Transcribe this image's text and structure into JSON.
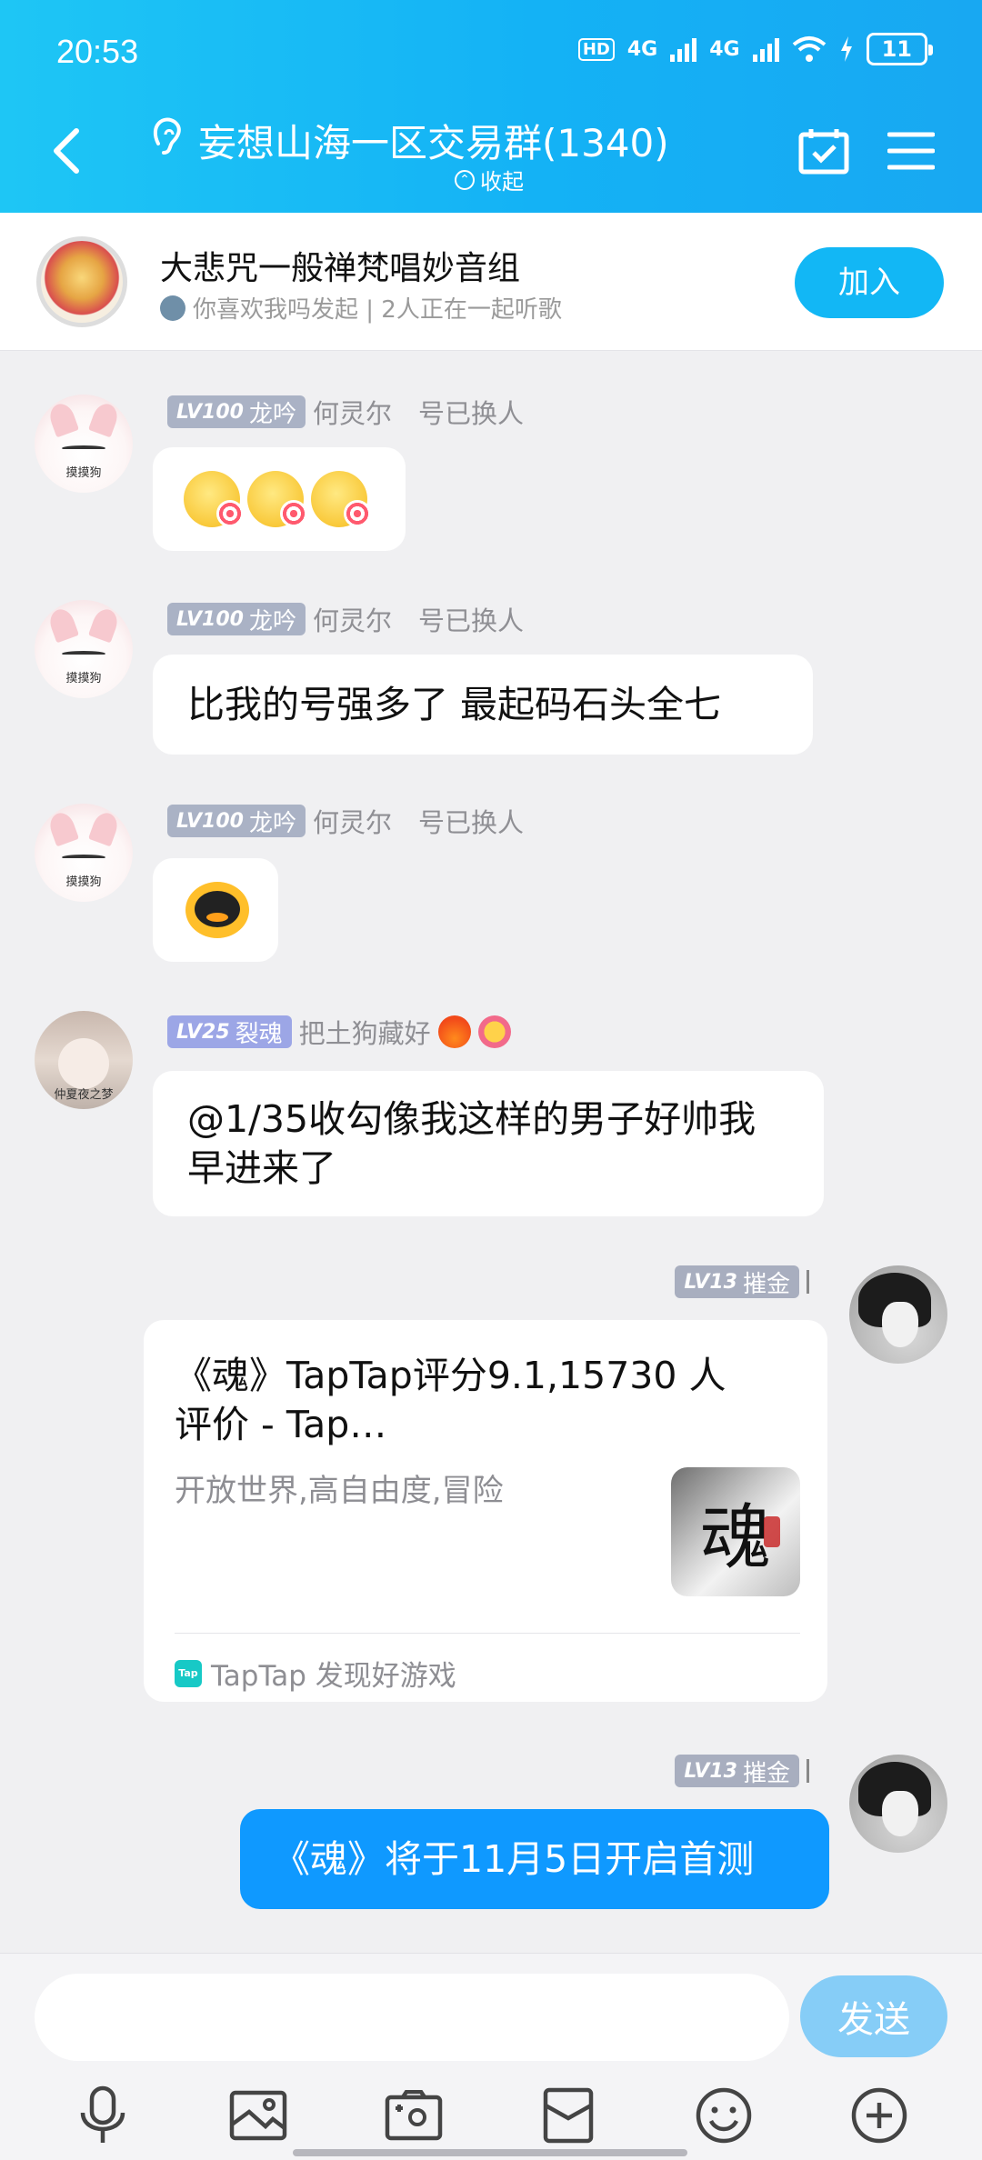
{
  "status_bar": {
    "time": "20:53",
    "network_hd": "HD",
    "net1": "4G",
    "net2": "4G",
    "battery": "11"
  },
  "header": {
    "title": "妄想山海一区交易群(1340)",
    "collapse_label": "收起",
    "background_color": "#14b2f5"
  },
  "banner": {
    "title": "大悲咒一般禅梵唱妙音组",
    "subtitle": "你喜欢我吗发起 | 2人正在一起听歌",
    "join_label": "加入"
  },
  "messages": [
    {
      "level": "LV100",
      "title": "龙吟",
      "nickname": "何灵尔　号已换人",
      "avatar_caption": "摸摸狗",
      "content_type": "emoji",
      "emoji": "lollipop-emoji x3"
    },
    {
      "level": "LV100",
      "title": "龙吟",
      "nickname": "何灵尔　号已换人",
      "avatar_caption": "摸摸狗",
      "content_type": "text",
      "text": "比我的号强多了 最起码石头全七"
    },
    {
      "level": "LV100",
      "title": "龙吟",
      "nickname": "何灵尔　号已换人",
      "avatar_caption": "摸摸狗",
      "content_type": "emoji",
      "emoji": "qq-penguin-emoji"
    },
    {
      "level": "LV25",
      "title": "裂魂",
      "nickname": "把土狗藏好",
      "avatar_caption": "仲夏夜之梦",
      "content_type": "text",
      "text": "@1/35收勾像我这样的男子好帅我早进来了"
    },
    {
      "level": "LV13",
      "title": "摧金",
      "nickname": "",
      "content_type": "card",
      "card": {
        "title": "《魂》TapTap评分9.1,15730 人评价 - Tap…",
        "description": "开放世界,高自由度,冒险",
        "thumb_text": "魂",
        "source": "TapTap 发现好游戏",
        "source_logo": "Tap"
      }
    },
    {
      "level": "LV13",
      "title": "摧金",
      "nickname": "",
      "content_type": "text",
      "text": "《魂》将于11月5日开启首测"
    }
  ],
  "composer": {
    "placeholder": "",
    "send_label": "发送",
    "tools": [
      "microphone-icon",
      "image-icon",
      "camera-icon",
      "red-packet-icon",
      "emoji-icon",
      "plus-icon"
    ]
  }
}
